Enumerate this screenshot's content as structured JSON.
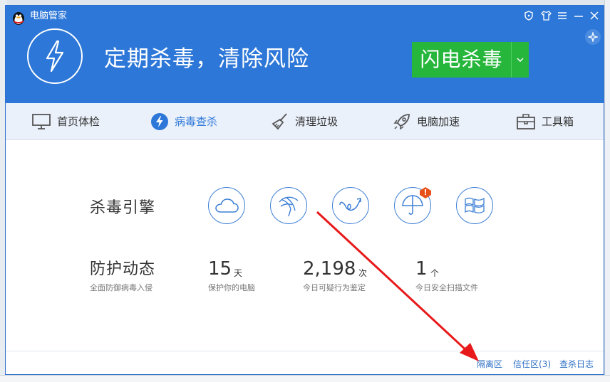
{
  "app": {
    "title": "电脑管家"
  },
  "hero": {
    "headline": "定期杀毒，清除风险",
    "scan_button": "闪电杀毒"
  },
  "tabs": [
    {
      "label": "首页体检",
      "icon": "monitor-icon"
    },
    {
      "label": "病毒查杀",
      "icon": "lightning-icon"
    },
    {
      "label": "清理垃圾",
      "icon": "broom-icon"
    },
    {
      "label": "电脑加速",
      "icon": "rocket-icon"
    },
    {
      "label": "工具箱",
      "icon": "toolbox-icon"
    }
  ],
  "engines": {
    "label": "杀毒引擎",
    "items": [
      "cloud-engine-icon",
      "fan-engine-icon",
      "spiral-engine-icon",
      "umbrella-engine-icon",
      "windows-engine-icon"
    ],
    "alert": "!"
  },
  "protection": {
    "label": "防护动态",
    "sublabel": "全面防御病毒入侵",
    "stats": [
      {
        "value": "15",
        "unit": "天",
        "desc": "保护你的电脑"
      },
      {
        "value": "2,198",
        "unit": "次",
        "desc": "今日可疑行为鉴定"
      },
      {
        "value": "1",
        "unit": "个",
        "desc": "今日安全扫描文件"
      }
    ]
  },
  "footer": {
    "quarantine": "隔离区",
    "trusted": "信任区(3)",
    "log": "查杀日志"
  },
  "colors": {
    "header": "#2d77d8",
    "scan": "#26b63b",
    "annotation": "#e8191a"
  }
}
